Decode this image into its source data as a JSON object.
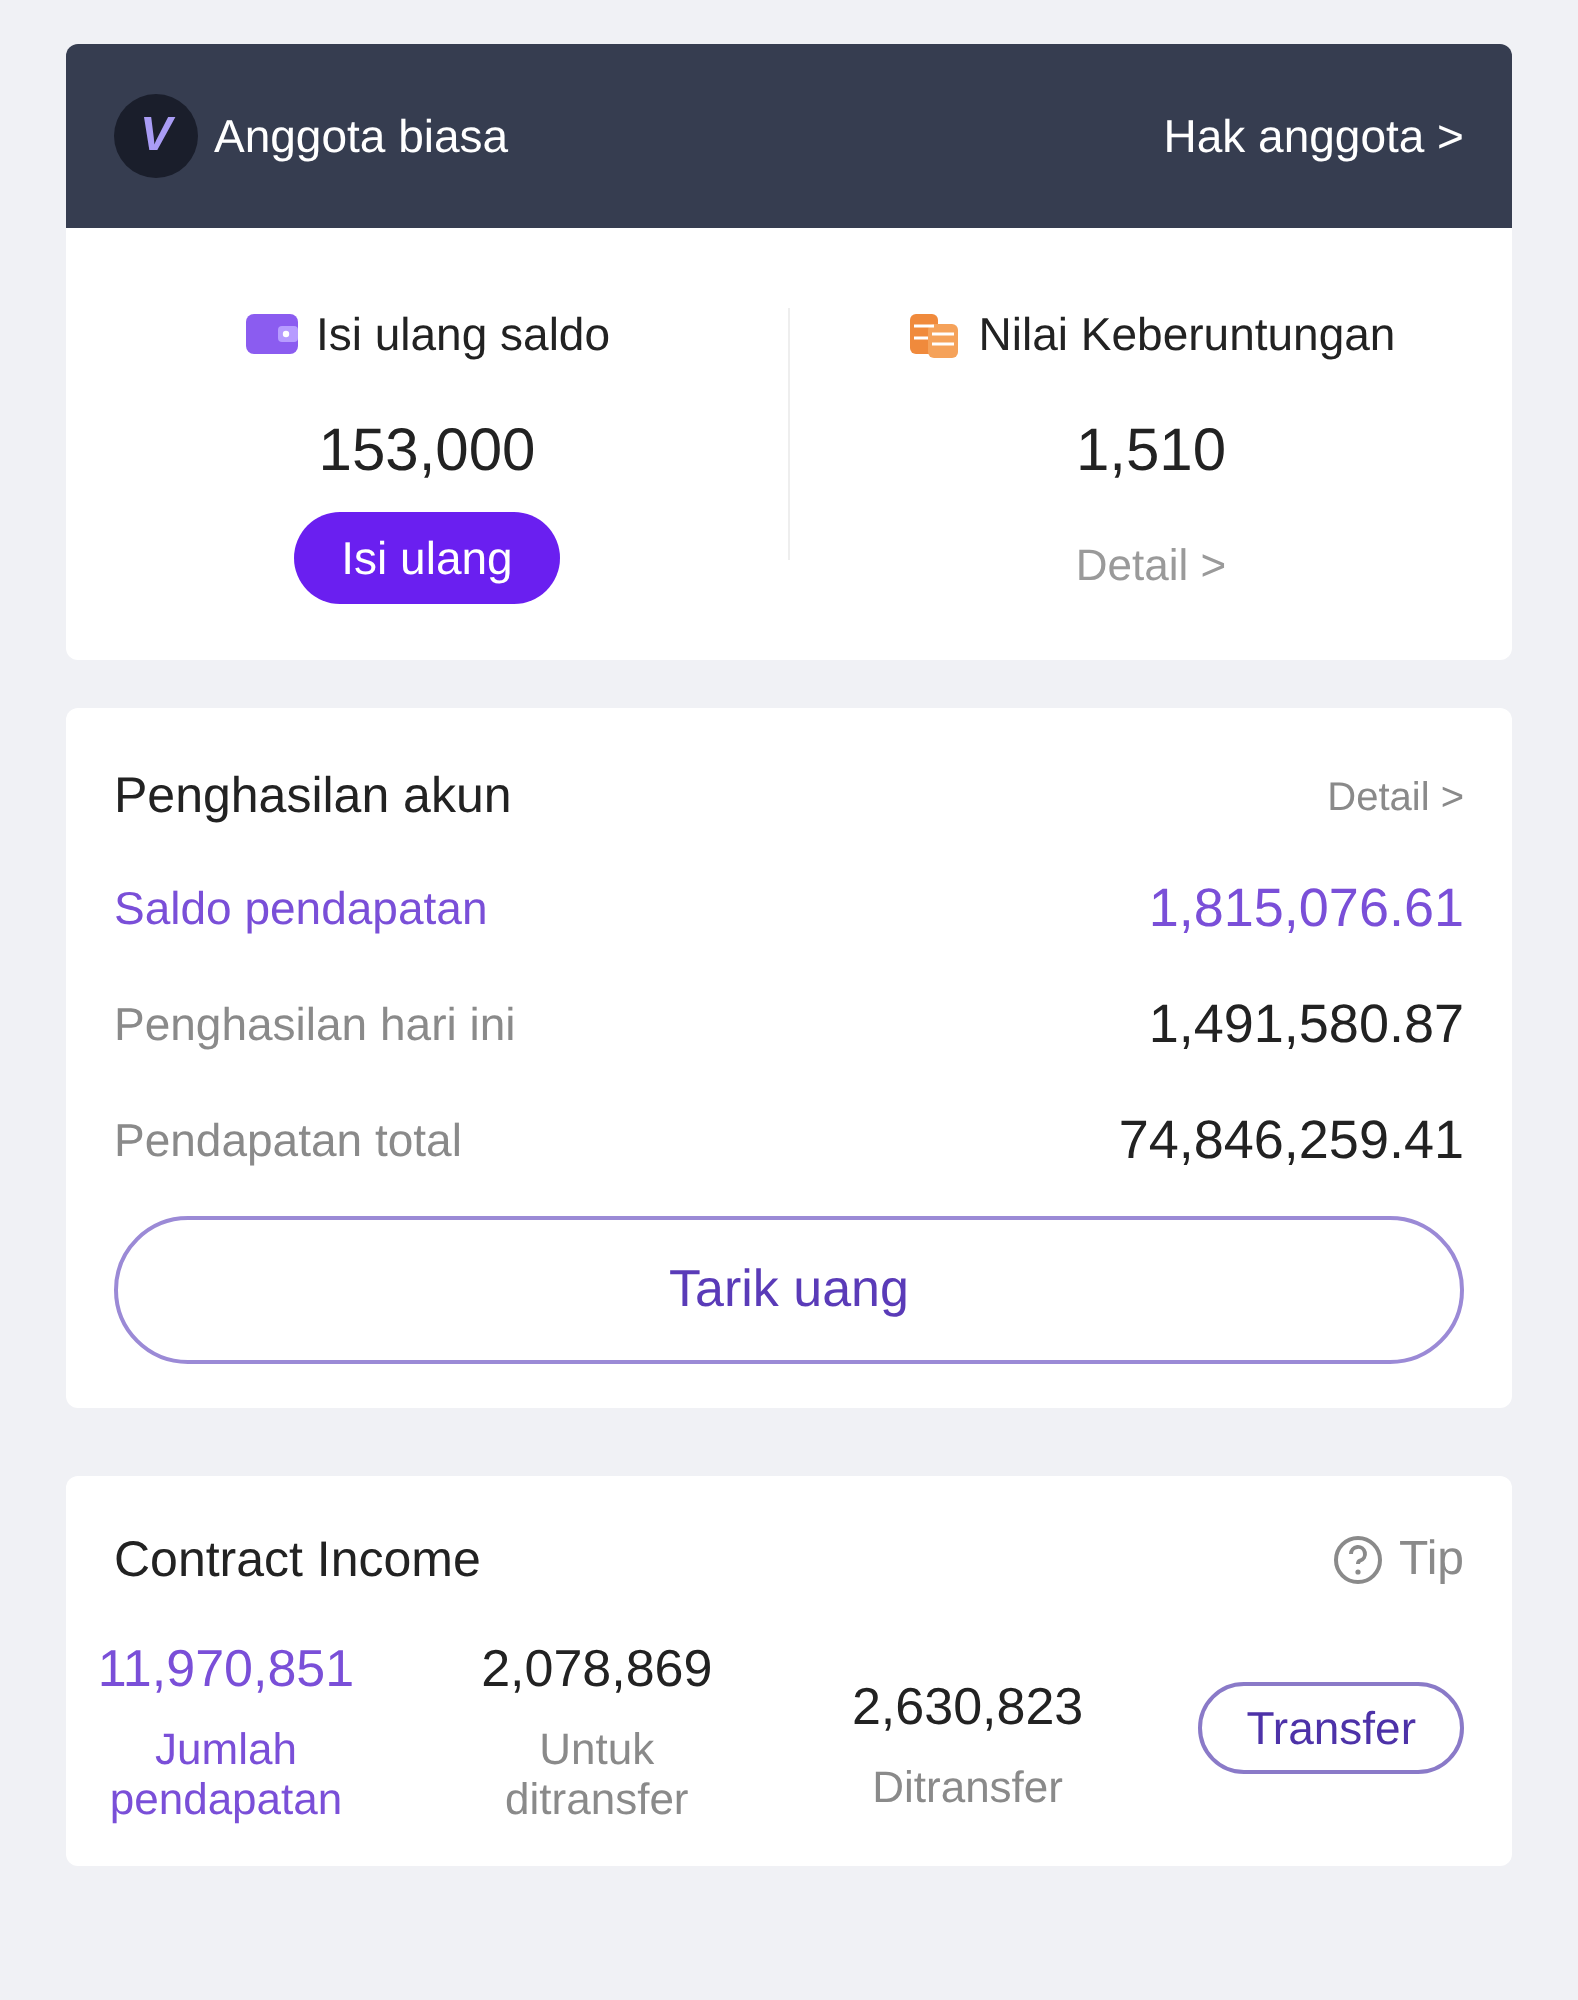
{
  "member": {
    "level": "Anggota biasa",
    "logo": "V",
    "link": "Hak anggota >"
  },
  "wallet": [
    {
      "kind": "recharge",
      "label": "Isi ulang saldo",
      "value": "153,000",
      "action": "Isi ulang"
    },
    {
      "kind": "luck",
      "label": "Nilai Keberuntungan",
      "value": "1,510",
      "action": "Detail >"
    }
  ],
  "earnings": {
    "title": "Penghasilan akun",
    "link": "Detail >",
    "rows": [
      {
        "label": "Saldo pendapatan",
        "value": "1,815,076.61",
        "highlighted": true
      },
      {
        "label": "Penghasilan hari ini",
        "value": "1,491,580.87",
        "highlighted": false
      },
      {
        "label": "Pendapatan total",
        "value": "74,846,259.41",
        "highlighted": false
      }
    ],
    "button": "Tarik uang"
  },
  "contract": {
    "title": "Contract Income",
    "tip": "Tip",
    "stats": [
      {
        "value": "11,970,851",
        "label": "Jumlah pendapatan",
        "highlighted": true
      },
      {
        "value": "2,078,869",
        "label": "Untuk ditransfer",
        "highlighted": false
      },
      {
        "value": "2,630,823",
        "label": "Ditransfer",
        "highlighted": false
      }
    ],
    "button": "Transfer"
  }
}
